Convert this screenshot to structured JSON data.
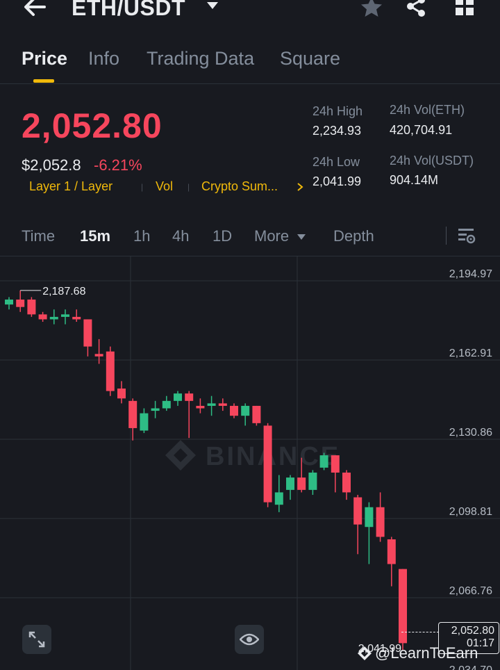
{
  "header": {
    "pair": "ETH/USDT"
  },
  "tabs": [
    {
      "label": "Price",
      "active": true
    },
    {
      "label": "Info",
      "active": false
    },
    {
      "label": "Trading Data",
      "active": false
    },
    {
      "label": "Square",
      "active": false
    }
  ],
  "price": {
    "last": "2,052.80",
    "usd": "$2,052.8",
    "change": "-6.21%",
    "color_down": "#f6465d",
    "color_up": "#2ebd85",
    "accent": "#f0b90b"
  },
  "tags": [
    "Layer 1 / Layer",
    "Vol",
    "Crypto Sum..."
  ],
  "stats": {
    "high_label": "24h High",
    "high_value": "2,234.93",
    "low_label": "24h Low",
    "low_value": "2,041.99",
    "vol_eth_label": "24h Vol(ETH)",
    "vol_eth_value": "420,704.91",
    "vol_usdt_label": "24h Vol(USDT)",
    "vol_usdt_value": "904.14M"
  },
  "timeframes": [
    {
      "label": "Time",
      "active": false
    },
    {
      "label": "15m",
      "active": true
    },
    {
      "label": "1h",
      "active": false
    },
    {
      "label": "4h",
      "active": false
    },
    {
      "label": "1D",
      "active": false
    },
    {
      "label": "More",
      "active": false
    },
    {
      "label": "Depth",
      "active": false
    }
  ],
  "chart_data": {
    "type": "candlestick",
    "y_ticks": [
      "2,194.97",
      "2,162.91",
      "2,130.86",
      "2,098.81",
      "2,066.76",
      "2,034.70"
    ],
    "ylim": [
      2034.7,
      2194.97
    ],
    "high_marker": "2,187.68",
    "low_marker": "2,041.99",
    "last_price": "2,052.80",
    "countdown": "01:17",
    "watermark": "BINANCE",
    "candles": [
      {
        "o": 2182,
        "c": 2184,
        "h": 2185,
        "l": 2180
      },
      {
        "o": 2184,
        "c": 2181,
        "h": 2187.68,
        "l": 2179
      },
      {
        "o": 2184,
        "c": 2178,
        "h": 2185,
        "l": 2177
      },
      {
        "o": 2178,
        "c": 2176,
        "h": 2179,
        "l": 2175
      },
      {
        "o": 2176,
        "c": 2177,
        "h": 2180,
        "l": 2174
      },
      {
        "o": 2177,
        "c": 2178,
        "h": 2180,
        "l": 2174
      },
      {
        "o": 2177,
        "c": 2176,
        "h": 2180,
        "l": 2175
      },
      {
        "o": 2176,
        "c": 2165,
        "h": 2176,
        "l": 2161
      },
      {
        "o": 2162,
        "c": 2161,
        "h": 2168,
        "l": 2158
      },
      {
        "o": 2163,
        "c": 2147,
        "h": 2165,
        "l": 2145
      },
      {
        "o": 2148,
        "c": 2144,
        "h": 2151,
        "l": 2142
      },
      {
        "o": 2143,
        "c": 2132,
        "h": 2144,
        "l": 2127
      },
      {
        "o": 2131,
        "c": 2138,
        "h": 2140,
        "l": 2130
      },
      {
        "o": 2139,
        "c": 2140,
        "h": 2143,
        "l": 2136
      },
      {
        "o": 2140,
        "c": 2143,
        "h": 2145,
        "l": 2139
      },
      {
        "o": 2143,
        "c": 2146,
        "h": 2147,
        "l": 2141
      },
      {
        "o": 2146,
        "c": 2143,
        "h": 2147,
        "l": 2128
      },
      {
        "o": 2141,
        "c": 2140,
        "h": 2144,
        "l": 2138
      },
      {
        "o": 2141,
        "c": 2142,
        "h": 2145,
        "l": 2137
      },
      {
        "o": 2142,
        "c": 2141,
        "h": 2144,
        "l": 2139
      },
      {
        "o": 2141,
        "c": 2137,
        "h": 2142,
        "l": 2136
      },
      {
        "o": 2137,
        "c": 2141,
        "h": 2142,
        "l": 2133
      },
      {
        "o": 2141,
        "c": 2134,
        "h": 2141,
        "l": 2133
      },
      {
        "o": 2133,
        "c": 2102,
        "h": 2134,
        "l": 2100
      },
      {
        "o": 2101,
        "c": 2106,
        "h": 2113,
        "l": 2098
      },
      {
        "o": 2107,
        "c": 2112,
        "h": 2113,
        "l": 2103
      },
      {
        "o": 2112,
        "c": 2107,
        "h": 2120,
        "l": 2106
      },
      {
        "o": 2107,
        "c": 2114,
        "h": 2115,
        "l": 2105
      },
      {
        "o": 2116,
        "c": 2121,
        "h": 2122,
        "l": 2115
      },
      {
        "o": 2121,
        "c": 2114,
        "h": 2121,
        "l": 2106
      },
      {
        "o": 2114,
        "c": 2106,
        "h": 2115,
        "l": 2103
      },
      {
        "o": 2104,
        "c": 2093,
        "h": 2105,
        "l": 2081
      },
      {
        "o": 2092,
        "c": 2100,
        "h": 2102,
        "l": 2077
      },
      {
        "o": 2100,
        "c": 2088,
        "h": 2106,
        "l": 2086
      },
      {
        "o": 2087,
        "c": 2077,
        "h": 2088,
        "l": 2068
      },
      {
        "o": 2075,
        "c": 2045,
        "h": 2075,
        "l": 2041.99
      }
    ]
  },
  "footer": {
    "user_watermark": "@LearnToEarn"
  }
}
